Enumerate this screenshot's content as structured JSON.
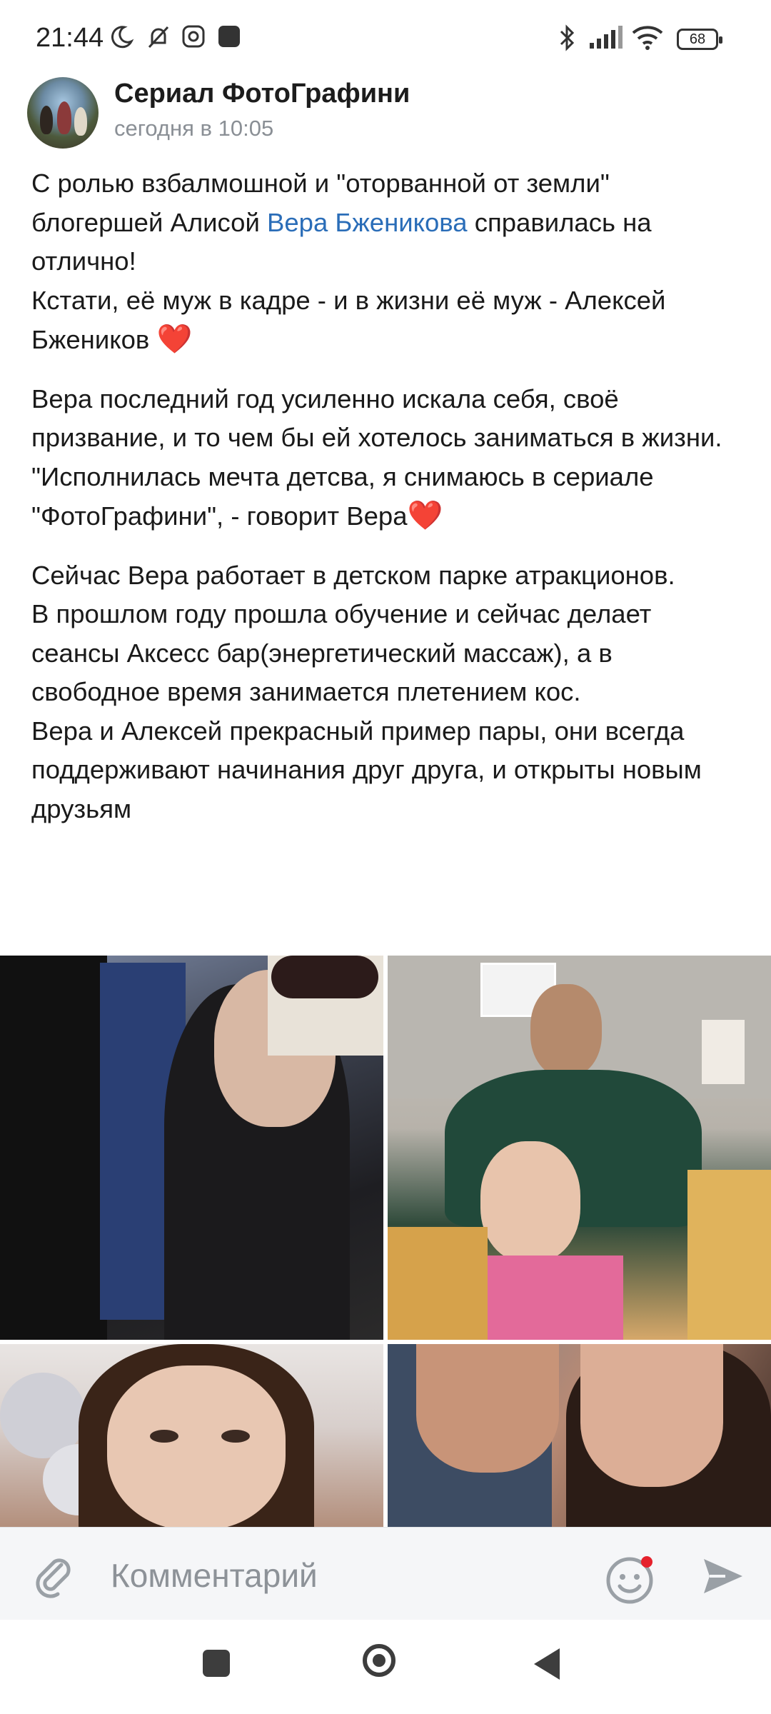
{
  "status_bar": {
    "time": "21:44",
    "battery": "68",
    "icons": [
      "moon-icon",
      "bell-off-icon",
      "instagram-icon",
      "app-icon",
      "bluetooth-icon",
      "signal-icon",
      "wifi-icon",
      "battery-icon"
    ]
  },
  "post": {
    "group_name": "Сериал ФотоГрафини",
    "time": "сегодня в 10:05",
    "paragraph1": {
      "before_mention": "С ролью взбалмошной и \"оторванной от земли\" блогершей Алисой ",
      "mention": "Вера Бженикова",
      "after_mention": " справилась на отлично!",
      "line2": "Кстати, её муж в кадре - и в жизни её муж - Алексей Бжеников",
      "heart": "❤️"
    },
    "paragraph2": {
      "line1": " Вера последний год усиленно искала себя, своё призвание, и то чем бы ей хотелось заниматься в жизни.",
      "line2": "\"Исполнилась мечта детсва, я снимаюсь в сериале \"ФотоГрафини\", - говорит Вера",
      "heart": "❤️"
    },
    "paragraph3": {
      "line1": "Сейчас  Вера работает в детском парке атракционов.",
      "line2": "В прошлом году прошла обучение и сейчас делает сеансы Аксесс бар(энергетический массаж), а в свободное время занимается плетением кос.",
      "line3": " Вера и Алексей прекрасный пример пары, они всегда поддерживают начинания друг друга, и открыты новым друзьям"
    }
  },
  "comment_bar": {
    "placeholder": "Комментарий"
  },
  "nav": {
    "buttons": [
      "recents-button",
      "home-button",
      "back-button"
    ]
  },
  "colors": {
    "link": "#2a6db8",
    "heart": "#e0102a",
    "muted": "#8a8f95"
  }
}
